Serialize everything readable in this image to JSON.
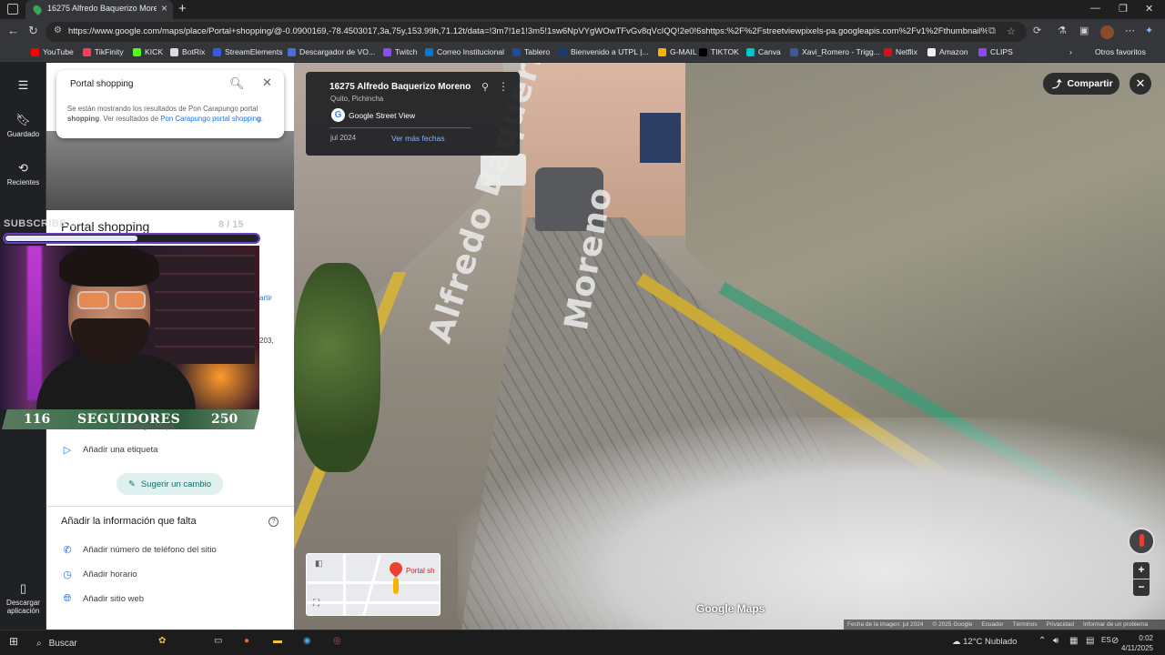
{
  "browser": {
    "tab_title": "16275 Alfredo Baquerizo Moreno",
    "url": "https://www.google.com/maps/place/Portal+shopping/@-0.0900169,-78.4503017,3a,75y,153.99h,71.12t/data=!3m7!1e1!3m5!1sw6NpVYgWOwTFvGv8qVcIQQ!2e0!6shttps:%2F%2Fstreetviewpixels-pa.googleapis.com%2Fv1%2Fthumbnail%3Fcb...",
    "bookmarks": [
      {
        "label": "YouTube",
        "color": "#ff0000"
      },
      {
        "label": "TikFinity",
        "color": "#ff3b5c"
      },
      {
        "label": "KICK",
        "color": "#53fc18"
      },
      {
        "label": "BotRix",
        "color": "#dddddd"
      },
      {
        "label": "StreamElements",
        "color": "#3a5bd9"
      },
      {
        "label": "Descargador de VO...",
        "color": "#4e6cd6"
      },
      {
        "label": "Twitch",
        "color": "#9146ff"
      },
      {
        "label": "Correo Institucional",
        "color": "#0078d4"
      },
      {
        "label": "Tablero",
        "color": "#1e4b9c"
      },
      {
        "label": "Bienvenido a UTPL |...",
        "color": "#1a3b73"
      },
      {
        "label": "G-MAIL",
        "color": "#f4b400"
      },
      {
        "label": "TIKTOK",
        "color": "#000000"
      },
      {
        "label": "Canva",
        "color": "#00c4cc"
      },
      {
        "label": "Xavi_Romero - Trigg...",
        "color": "#3b5998"
      },
      {
        "label": "Netflix",
        "color": "#e50914"
      },
      {
        "label": "Amazon",
        "color": "#f0f0f0"
      },
      {
        "label": "CLIPS",
        "color": "#9146ff"
      }
    ],
    "other_bookmarks": "Otros favoritos"
  },
  "rail": {
    "saved": "Guardado",
    "recent": "Recientes",
    "download": "Descargar aplicación"
  },
  "search": {
    "query": "Portal shopping",
    "note_prefix": "Se están mostrando los resultados de Pon Carapungo portal ",
    "note_bold": "shopping",
    "note_mid": ". Ver resultados de ",
    "note_link": "Pon Carapungo portal shoppin",
    "note_end": "."
  },
  "panel": {
    "title": "Portal shopping",
    "counter": "8 / 15",
    "add_label": "Añadir una etiqueta",
    "suggest": "Sugerir un cambio",
    "missing_heading": "Añadir la información que falta",
    "add_phone": "Añadir número de teléfono del sitio",
    "add_hours": "Añadir horario",
    "add_website": "Añadir sitio web",
    "partial_maps": "...en Google Maps",
    "partial_share": "artir",
    "partial_year": "203,"
  },
  "overlay": {
    "subscribe": "SUBSCRIBE...",
    "progress": 0.52,
    "followers_current": "116",
    "followers_label": "SEGUIDORES",
    "followers_goal": "250"
  },
  "streetview": {
    "address": "16275 Alfredo Baquerizo Moreno",
    "locality": "Quito, Pichincha",
    "provider": "Google Street View",
    "date": "jul 2024",
    "more_dates": "Ver más fechas",
    "street_label_1": "Alfredo Baquerizo",
    "street_label_2": "Moreno",
    "share": "Compartir",
    "logo": "Google Maps",
    "attribution": [
      "Fecha de la imagen: jul 2024",
      "© 2025 Google",
      "Ecuador",
      "Términos",
      "Privacidad",
      "Informar de un problema"
    ],
    "minimap_label": "Portal sh"
  },
  "taskbar": {
    "search": "Buscar",
    "weather": "12°C  Nublado",
    "time": "0:02",
    "date": "4/11/2025"
  }
}
